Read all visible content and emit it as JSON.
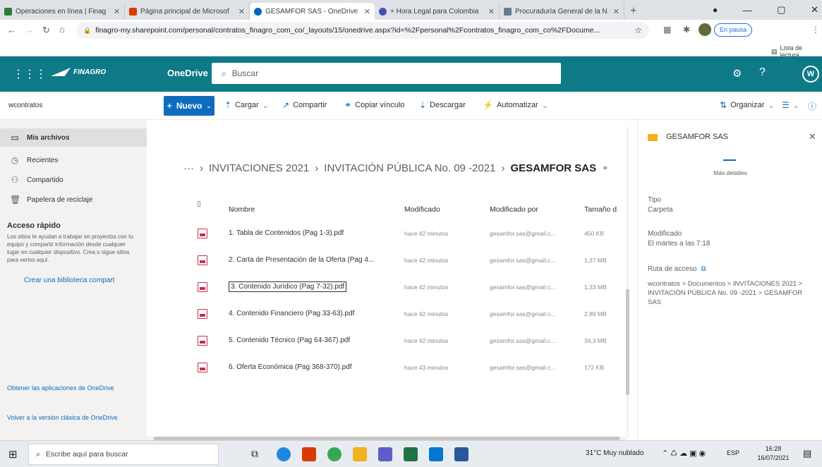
{
  "browser": {
    "tabs": [
      {
        "title": "Operaciones en línea | Finag",
        "color": "#2e7d32"
      },
      {
        "title": "Página principal de Microsof",
        "color": "#d83b01"
      },
      {
        "title": "GESAMFOR SAS - OneDrive",
        "color": "#0364b8",
        "active": true
      },
      {
        "title": "+ Hora Legal para Colombia",
        "color": "#3f51b5"
      },
      {
        "title": "Procuraduría General de la N",
        "color": "#607d8b"
      }
    ],
    "url": "finagro-my.sharepoint.com/personal/contratos_finagro_com_co/_layouts/15/onedrive.aspx?id=%2Fpersonal%2Fcontratos_finagro_com_co%2FDocume...",
    "profile_label": "En pausa",
    "reading_list": "Lista de lectura"
  },
  "suite": {
    "logo_text": "FINAGRO",
    "app_name": "OneDrive",
    "search_placeholder": "Buscar",
    "avatar_initial": "W"
  },
  "commands": {
    "new": "Nuevo",
    "upload": "Cargar",
    "share": "Compartir",
    "copy_link": "Copiar vínculo",
    "download": "Descargar",
    "automate": "Automatizar",
    "organize": "Organizar"
  },
  "nav": {
    "user": "wcontratos",
    "items": [
      "Mis archivos",
      "Recientes",
      "Compartido",
      "Papelera de reciclaje"
    ],
    "quick_access_title": "Acceso rápido",
    "quick_access_text": "Los sitios te ayudan a trabajar en proyectos con tu equipo y compartir información desde cualquier lugar en cualquier dispositivo. Crea o sigue sitios para verlos aquí.",
    "create_library": "Crear una biblioteca compart",
    "get_apps": "Obtener las aplicaciones de OneDrive",
    "classic": "Volver a la versión clásica de OneDrive"
  },
  "breadcrumb": {
    "ellipsis": "···",
    "b1": "INVITACIONES 2021",
    "b2": "INVITACIÓN PÚBLICA No. 09 -2021",
    "current": "GESAMFOR SAS"
  },
  "columns": {
    "name": "Nombre",
    "modified": "Modificado",
    "modified_by": "Modificado por",
    "size": "Tamaño d"
  },
  "files": [
    {
      "name": "1. Tabla de Contenidos (Pag 1-3).pdf",
      "modified": "hace 42 minutos",
      "by": "gesamfor.sas@gmail.c...",
      "size": "450 KB"
    },
    {
      "name": "2. Carta de Presentación de la Oferta (Pag 4...",
      "modified": "hace 42 minutos",
      "by": "gesamfor.sas@gmail.c...",
      "size": "1,37 MB"
    },
    {
      "name": "3. Contenido Jurídico (Pag 7-32).pdf",
      "modified": "hace 42 minutos",
      "by": "gesamfor.sas@gmail.c...",
      "size": "1,33 MB"
    },
    {
      "name": "4. Contenido Financiero (Pag 33-63).pdf",
      "modified": "hace 42 minutos",
      "by": "gesamfor.sas@gmail.c...",
      "size": "2,86 MB"
    },
    {
      "name": "5. Contenido Técnico (Pag 64-367).pdf",
      "modified": "hace 42 minutos",
      "by": "gesamfor.sas@gmail.c...",
      "size": "34,3 MB"
    },
    {
      "name": "6. Oferta Económica (Pag 368-370).pdf",
      "modified": "hace 43 minutos",
      "by": "gesamfor.sas@gmail.c...",
      "size": "172 KB"
    }
  ],
  "details": {
    "title": "GESAMFOR SAS",
    "more": "Más detalles",
    "type_label": "Tipo",
    "type_value": "Carpeta",
    "modified_label": "Modificado",
    "modified_value": "El martes a las 7:18",
    "path_label": "Ruta de acceso",
    "path_value": "wcontratos > Documentos > INVITACIONES 2021 > INVITACIÓN PÚBLICA No. 09 -2021 > GESAMFOR SAS"
  },
  "taskbar": {
    "search_placeholder": "Escribe aquí para buscar",
    "weather": "31°C  Muy nublado",
    "lang": "ESP",
    "time": "16:28",
    "date": "16/07/2021"
  }
}
